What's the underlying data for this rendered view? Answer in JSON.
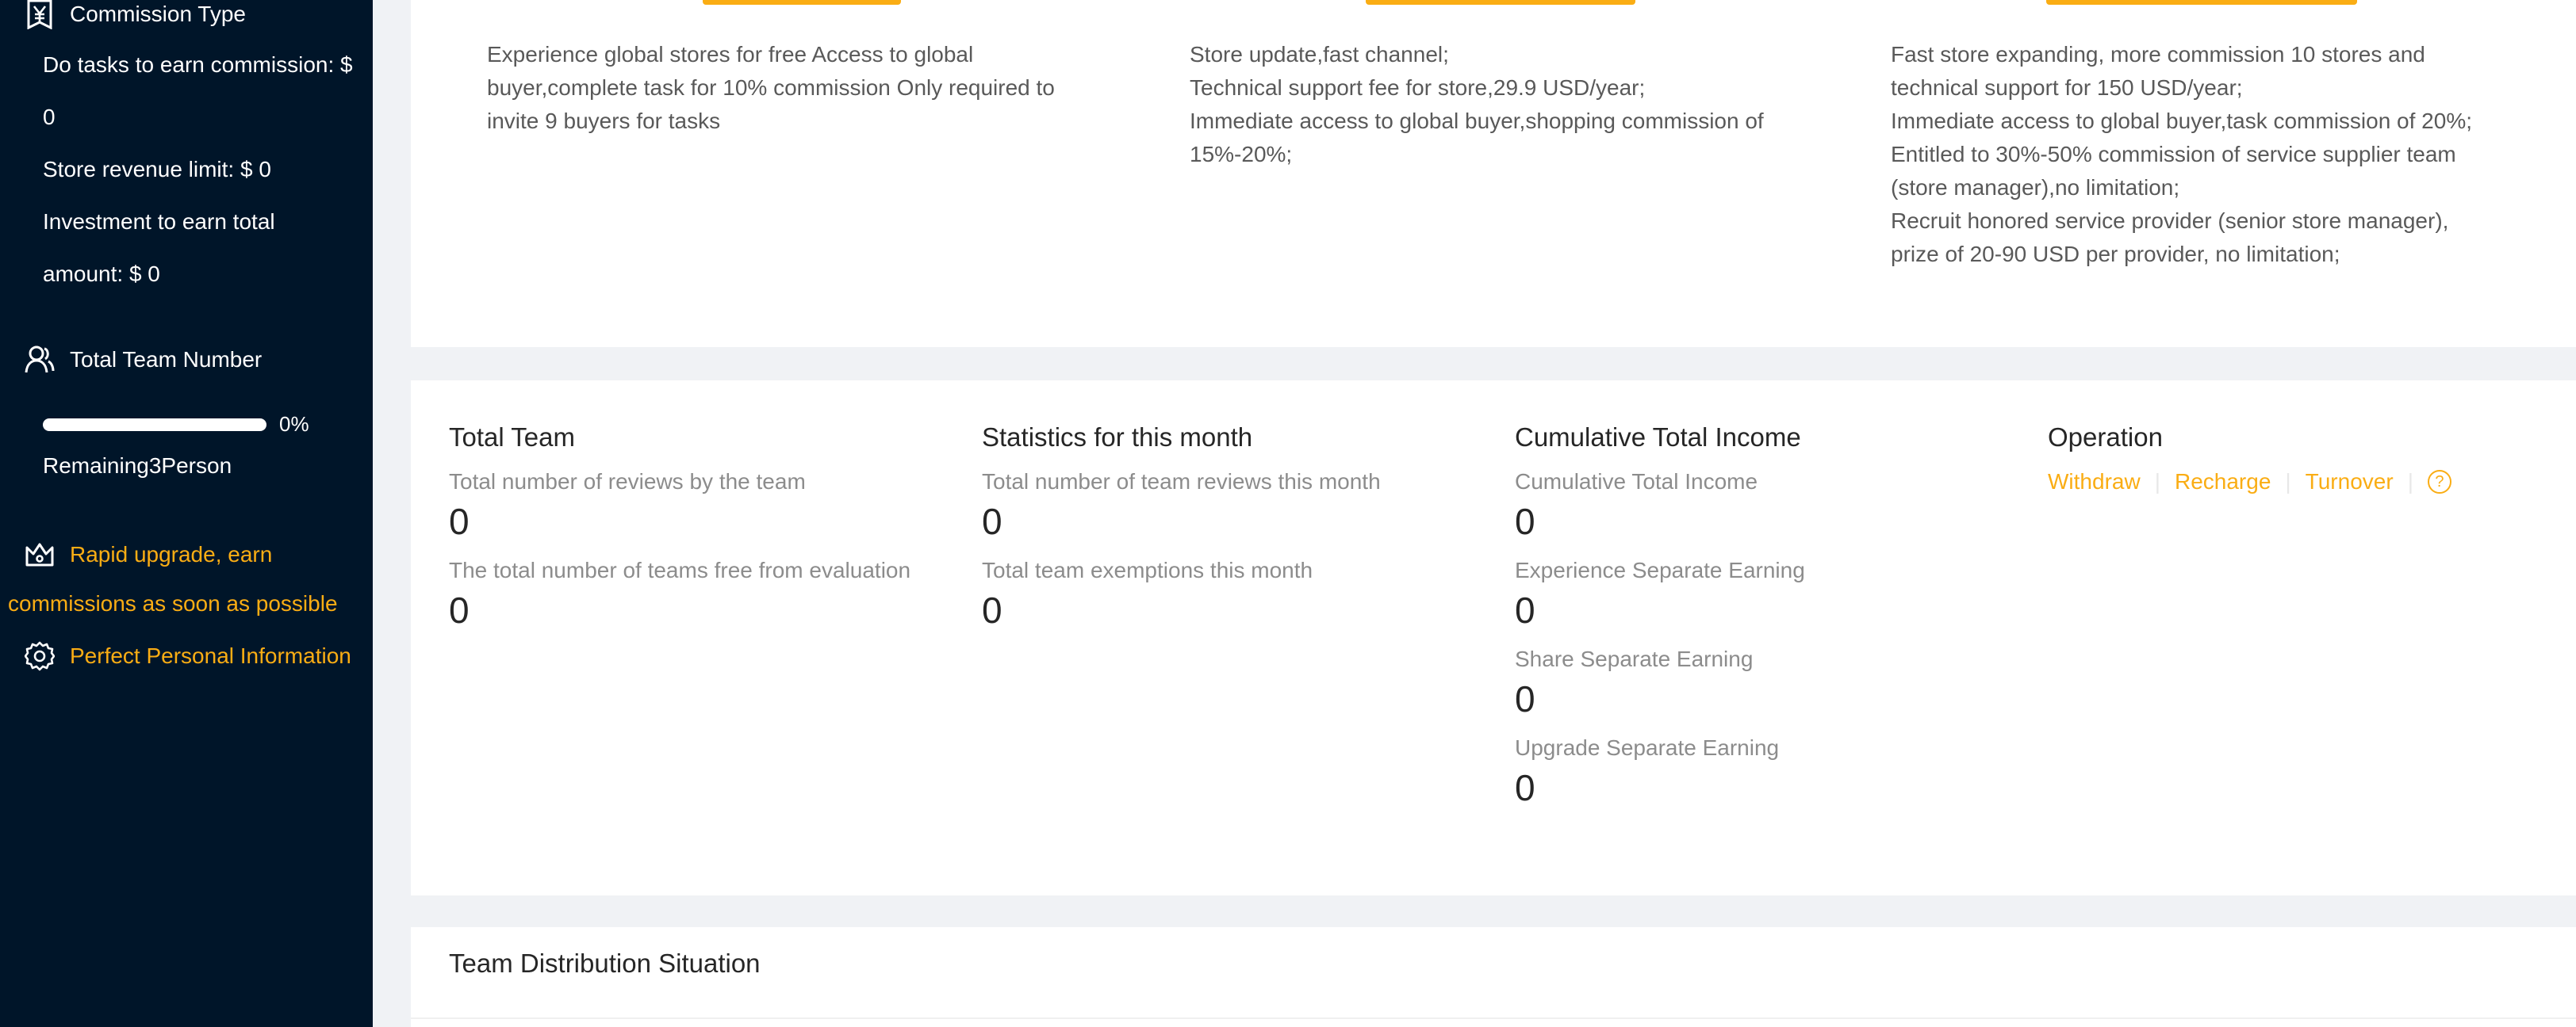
{
  "sidebar": {
    "commission_type": "Commission Type",
    "tasks_commission_line1": "Do tasks to earn commission: $",
    "tasks_commission_line2": "0",
    "store_revenue": "Store revenue limit: $ 0",
    "investment_line1": "Investment to earn total",
    "investment_line2": "amount: $ 0",
    "team_number": "Total Team Number",
    "progress_value": 0,
    "progress_label": "0%",
    "remaining": "Remaining3Person",
    "upgrade_line1": "Rapid upgrade, earn",
    "upgrade_line2": "commissions as soon as possible",
    "personal_info": "Perfect Personal Information"
  },
  "plans": [
    {
      "lines": [
        "Experience global stores for free Access to global",
        "buyer,complete task for 10% commission Only required to",
        "invite 9 buyers for tasks"
      ]
    },
    {
      "lines": [
        "Store update,fast channel;",
        "Technical support fee for store,29.9 USD/year;",
        "Immediate access to global buyer,shopping commission of",
        "15%-20%;"
      ]
    },
    {
      "lines": [
        "Fast store expanding, more commission 10 stores and",
        "technical support for 150 USD/year;",
        "Immediate access to global buyer,task commission of 20%;",
        "Entitled to 30%-50% commission of service supplier team",
        "(store manager),no limitation;",
        "Recruit honored service provider (senior store manager),",
        "prize of 20-90 USD per provider, no limitation;"
      ]
    }
  ],
  "stats": {
    "team": {
      "title": "Total Team",
      "reviews_label": "Total number of reviews by the team",
      "reviews_value": "0",
      "free_label": "The total number of teams free from evaluation",
      "free_value": "0"
    },
    "month": {
      "title": "Statistics for this month",
      "reviews_label": "Total number of team reviews this month",
      "reviews_value": "0",
      "exemptions_label": "Total team exemptions this month",
      "exemptions_value": "0"
    },
    "income": {
      "title": "Cumulative Total Income",
      "total_label": "Cumulative Total Income",
      "total_value": "0",
      "experience_label": "Experience Separate Earning",
      "experience_value": "0",
      "share_label": "Share Separate Earning",
      "share_value": "0",
      "upgrade_label": "Upgrade Separate Earning",
      "upgrade_value": "0"
    },
    "operation": {
      "title": "Operation",
      "withdraw": "Withdraw",
      "recharge": "Recharge",
      "turnover": "Turnover",
      "help_icon": "question-circle-icon"
    }
  },
  "distribution": {
    "title": "Team Distribution Situation"
  },
  "colors": {
    "sidebar_bg": "#001529",
    "accent": "#faad14",
    "page_bg": "#f0f2f5"
  }
}
